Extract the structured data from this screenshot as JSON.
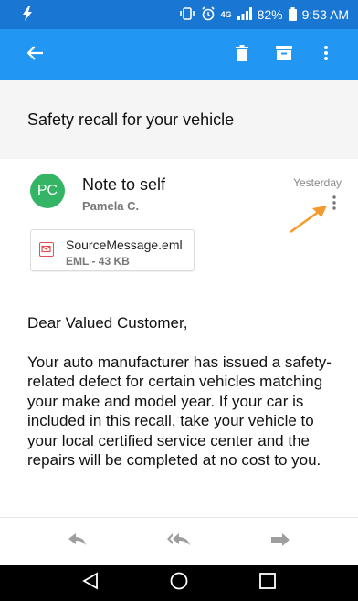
{
  "status_bar": {
    "battery": "82%",
    "time": "9:53 AM",
    "network": "4G"
  },
  "app_bar": {
    "icons": [
      "back-arrow-icon",
      "delete-icon",
      "archive-icon",
      "more-vert-icon"
    ]
  },
  "message": {
    "subject": "Safety recall for your vehicle",
    "avatar_initials": "PC",
    "title": "Note to self",
    "sender": "Pamela C.",
    "date": "Yesterday"
  },
  "attachment": {
    "name": "SourceMessage.eml",
    "meta": "EML - 43 KB"
  },
  "body": {
    "greeting": "Dear Valued Customer,",
    "paragraph": "Your auto manufacturer has issued a safety-related defect for certain vehicles matching your make and model year. If your car is included in this recall, take your vehicle to your local certified service center and the repairs will be completed at no cost to you."
  },
  "actions": {
    "icons": [
      "reply-icon",
      "reply-all-icon",
      "forward-icon"
    ]
  },
  "colors": {
    "status_bar": "#1976d2",
    "app_bar": "#2196f3",
    "avatar": "#34b566",
    "annotation": "#f39a2c"
  }
}
